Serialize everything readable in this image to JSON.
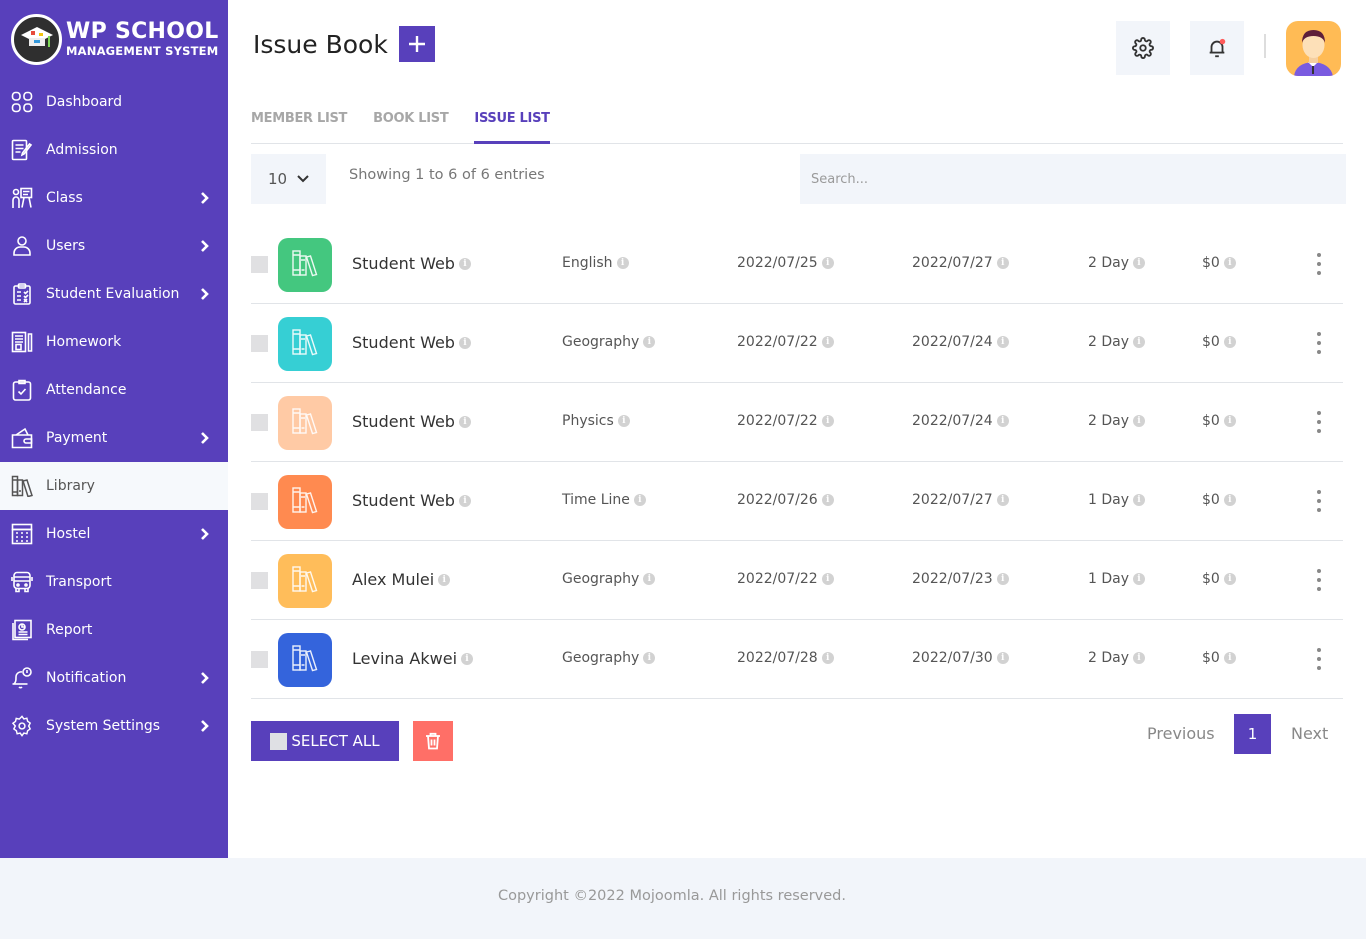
{
  "brand": {
    "title": "WP SCHOOL",
    "subtitle": "MANAGEMENT SYSTEM"
  },
  "sidebar": {
    "items": [
      {
        "label": "Dashboard",
        "icon": "dashboard-grid-icon",
        "has_submenu": false,
        "active": false
      },
      {
        "label": "Admission",
        "icon": "admission-form-icon",
        "has_submenu": false,
        "active": false
      },
      {
        "label": "Class",
        "icon": "class-teacher-icon",
        "has_submenu": true,
        "active": false
      },
      {
        "label": "Users",
        "icon": "user-icon",
        "has_submenu": true,
        "active": false
      },
      {
        "label": "Student Evaluation",
        "icon": "evaluation-clipboard-icon",
        "has_submenu": true,
        "active": false
      },
      {
        "label": "Homework",
        "icon": "homework-notebook-icon",
        "has_submenu": false,
        "active": false
      },
      {
        "label": "Attendance",
        "icon": "attendance-check-icon",
        "has_submenu": false,
        "active": false
      },
      {
        "label": "Payment",
        "icon": "wallet-icon",
        "has_submenu": true,
        "active": false
      },
      {
        "label": "Library",
        "icon": "library-books-icon",
        "has_submenu": false,
        "active": true
      },
      {
        "label": "Hostel",
        "icon": "hostel-building-icon",
        "has_submenu": true,
        "active": false
      },
      {
        "label": "Transport",
        "icon": "bus-icon",
        "has_submenu": false,
        "active": false
      },
      {
        "label": "Report",
        "icon": "report-icon",
        "has_submenu": false,
        "active": false
      },
      {
        "label": "Notification",
        "icon": "notification-bell-icon",
        "has_submenu": true,
        "active": false
      },
      {
        "label": "System Settings",
        "icon": "gear-icon",
        "has_submenu": true,
        "active": false
      }
    ]
  },
  "header": {
    "title": "Issue Book",
    "add_icon": "plus-icon",
    "settings_icon": "gear-icon",
    "notification_icon": "bell-icon",
    "notification_dot_color": "#ff5a5a"
  },
  "tabs": [
    {
      "label": "MEMBER LIST",
      "active": false
    },
    {
      "label": "BOOK LIST",
      "active": false
    },
    {
      "label": "ISSUE LIST",
      "active": true
    }
  ],
  "controls": {
    "page_length": "10",
    "info": "Showing 1 to 6 of 6 entries",
    "search_placeholder": "Search...",
    "search_value": ""
  },
  "table": {
    "rows": [
      {
        "name": "Student Web",
        "book": "English",
        "issue_date": "2022/07/25",
        "return_date": "2022/07/27",
        "period": "2 Day",
        "fine": "$0",
        "color": "#44c77f"
      },
      {
        "name": "Student Web",
        "book": "Geography",
        "issue_date": "2022/07/22",
        "return_date": "2022/07/24",
        "period": "2 Day",
        "fine": "$0",
        "color": "#36cfd4"
      },
      {
        "name": "Student Web",
        "book": "Physics",
        "issue_date": "2022/07/22",
        "return_date": "2022/07/24",
        "period": "2 Day",
        "fine": "$0",
        "color": "#ffcaa5"
      },
      {
        "name": "Student Web",
        "book": "Time Line",
        "issue_date": "2022/07/26",
        "return_date": "2022/07/27",
        "period": "1 Day",
        "fine": "$0",
        "color": "#ff8a50"
      },
      {
        "name": "Alex Mulei",
        "book": "Geography",
        "issue_date": "2022/07/22",
        "return_date": "2022/07/23",
        "period": "1 Day",
        "fine": "$0",
        "color": "#ffbd5a"
      },
      {
        "name": "Levina Akwei",
        "book": "Geography",
        "issue_date": "2022/07/28",
        "return_date": "2022/07/30",
        "period": "2 Day",
        "fine": "$0",
        "color": "#3464dc"
      }
    ]
  },
  "actions": {
    "select_all_label": "SELECT ALL",
    "delete_icon": "trash-icon"
  },
  "pagination": {
    "previous_label": "Previous",
    "current_page": "1",
    "next_label": "Next"
  },
  "footer": {
    "text": "Copyright ©2022 Mojoomla. All rights reserved."
  },
  "colors": {
    "primary": "#5840bb",
    "danger": "#ff6f67",
    "panel_bg": "#f2f5fa"
  }
}
